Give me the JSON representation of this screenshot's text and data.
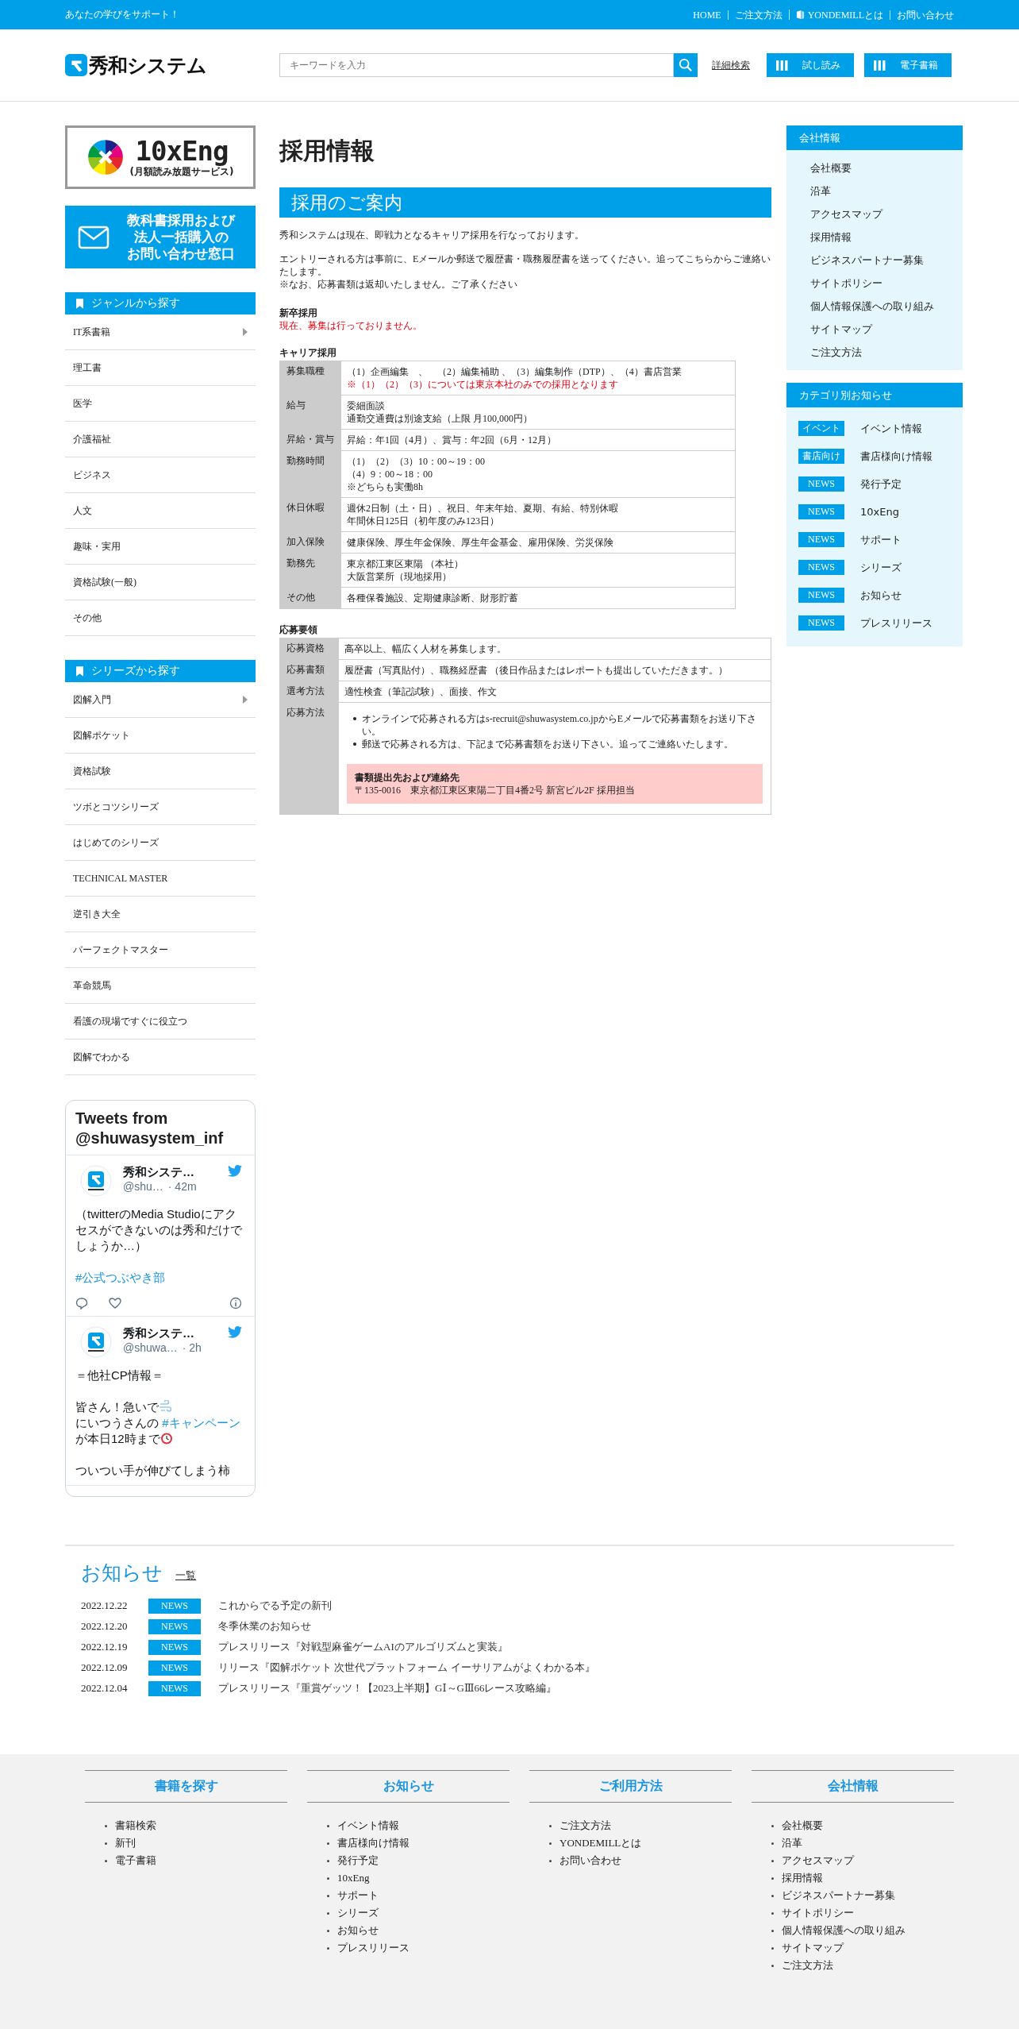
{
  "top_bar": {
    "tagline": "あなたの学びをサポート！",
    "links": [
      {
        "label": "HOME",
        "kind": "plain"
      },
      {
        "label": "ご注文方法",
        "kind": "plain"
      },
      {
        "label": "YONDEMILLとは",
        "kind": "app"
      },
      {
        "label": "お問い合わせ",
        "kind": "plain"
      }
    ]
  },
  "header": {
    "logo": "秀和システム",
    "search": {
      "placeholder": "キーワードを入力"
    },
    "advanced_search": "詳細検索",
    "buttons": [
      "試し読み",
      "電子書籍"
    ]
  },
  "left_sidebar": {
    "banner": {
      "title": "10xEng",
      "subtitle": "(月額読み放題サービス)"
    },
    "contact_banner": {
      "lines": [
        "教科書採用および",
        "法人一括購入の",
        "お問い合わせ窓口"
      ]
    },
    "genres": {
      "heading": "ジャンルから探す",
      "items": [
        {
          "label": "IT系書籍",
          "expandable": true
        },
        {
          "label": "理工書",
          "expandable": false
        },
        {
          "label": "医学",
          "expandable": false
        },
        {
          "label": "介護福祉",
          "expandable": false
        },
        {
          "label": "ビジネス",
          "expandable": false
        },
        {
          "label": "人文",
          "expandable": false
        },
        {
          "label": "趣味・実用",
          "expandable": false
        },
        {
          "label": "資格試験(一般)",
          "expandable": false
        },
        {
          "label": "その他",
          "expandable": false
        }
      ]
    },
    "series": {
      "heading": "シリーズから探す",
      "items": [
        {
          "label": "図解入門",
          "expandable": true
        },
        {
          "label": "図解ポケット",
          "expandable": false
        },
        {
          "label": "資格試験",
          "expandable": false
        },
        {
          "label": "ツボとコツシリーズ",
          "expandable": false
        },
        {
          "label": "はじめてのシリーズ",
          "expandable": false
        },
        {
          "label": "TECHNICAL MASTER",
          "expandable": false
        },
        {
          "label": "逆引き大全",
          "expandable": false
        },
        {
          "label": "パーフェクトマスター",
          "expandable": false
        },
        {
          "label": "革命競馬",
          "expandable": false
        },
        {
          "label": "看護の現場ですぐに役立つ",
          "expandable": false
        },
        {
          "label": "図解でわかる",
          "expandable": false
        }
      ]
    },
    "twitter": {
      "title": "Tweets from @shuwasystem_inf",
      "tweets": [
        {
          "name": "秀和システ…",
          "handle": "@shu…",
          "time": "· 42m",
          "body": [
            [
              [
                {
                  "kind": "text",
                  "text": "（twitterのMedia Studioにアクセスができないのは秀和だけでしょうか…）"
                }
              ]
            ],
            [
              [
                {
                  "kind": "tag",
                  "text": "#公式つぶやき部"
                }
              ]
            ]
          ],
          "actions": true
        },
        {
          "name": "秀和システ…",
          "handle": "@shuwa…",
          "time": "· 2h",
          "body": [
            [
              [
                {
                  "kind": "text",
                  "text": "＝他社CP情報＝"
                }
              ]
            ],
            [
              [
                {
                  "kind": "text",
                  "text": "皆さん！急いで"
                },
                {
                  "kind": "dash"
                }
              ],
              [
                {
                  "kind": "text",
                  "text": "にいつうさんの "
                },
                {
                  "kind": "tag",
                  "text": "#キャンペーン"
                },
                {
                  "kind": "text",
                  "text": " が本日12時まで"
                },
                {
                  "kind": "clock"
                }
              ]
            ],
            [
              [
                {
                  "kind": "text",
                  "text": "ついつい手が伸びてしまう柿"
                }
              ]
            ]
          ]
        }
      ]
    }
  },
  "main": {
    "title": "採用情報",
    "section_heading": "採用のご案内",
    "intro": [
      "秀和システムは現在、即戦力となるキャリア採用を行なっております。",
      "エントリーされる方は事前に、Eメールか郵送で履歴書・職務履歴書を送ってください。追ってこちらからご連絡いたします。\n※なお、応募書類は返却いたしません。ご了承ください"
    ],
    "new_grad": {
      "heading": "新卒採用",
      "notice": "現在、募集は行っておりません。"
    },
    "career": {
      "heading": "キャリア採用",
      "rows": [
        {
          "label": "募集職種",
          "lines": [
            "（1）企画編集　、　（2）編集補助 、（3）編集制作（DTP）、（4）書店営業"
          ],
          "note": "※（1）（2）（3）については東京本社のみでの採用となります"
        },
        {
          "label": "給与",
          "lines": [
            "委細面談",
            "通勤交通費は別途支給（上限 月100,000円）"
          ]
        },
        {
          "label": "昇給・賞与",
          "lines": [
            "昇給：年1回（4月）、賞与：年2回（6月・12月）"
          ]
        },
        {
          "label": "勤務時間",
          "lines": [
            "（1）（2）（3）10：00～19：00",
            "（4）9：00～18：00",
            "※どちらも実働8h"
          ]
        },
        {
          "label": "休日休暇",
          "lines": [
            "週休2日制（土・日）、祝日、年末年始、夏期、有給、特別休暇",
            "年間休日125日（初年度のみ123日）"
          ]
        },
        {
          "label": "加入保険",
          "lines": [
            "健康保険、厚生年金保険、厚生年金基金、雇用保険、労災保険"
          ]
        },
        {
          "label": "勤務先",
          "lines": [
            "東京都江東区東陽 （本社）",
            "大阪営業所（現地採用）"
          ]
        },
        {
          "label": "その他",
          "lines": [
            "各種保養施設、定期健康診断、財形貯蓄"
          ]
        }
      ]
    },
    "application": {
      "heading": "応募要領",
      "rows": [
        {
          "label": "応募資格",
          "text": "高卒以上、幅広く人材を募集します。"
        },
        {
          "label": "応募書類",
          "text": "履歴書（写真貼付）、職務経歴書 （後日作品またはレポートも提出していただきます。）"
        },
        {
          "label": "選考方法",
          "text": "適性検査（筆記試験）、面接、作文"
        }
      ],
      "method": {
        "label": "応募方法",
        "bullets": [
          "オンラインで応募される方はs-recruit@shuwasystem.co.jpからEメールで応募書類をお送り下さい。",
          "郵送で応募される方は、下記まで応募書類をお送り下さい。追ってご連絡いたします。"
        ],
        "contact": {
          "heading": "書類提出先および連絡先",
          "address": "〒135-0016　東京都江東区東陽二丁目4番2号 新宮ビル2F 採用担当"
        }
      }
    }
  },
  "right_sidebar": {
    "company": {
      "heading": "会社情報",
      "items": [
        "会社概要",
        "沿革",
        "アクセスマップ",
        "採用情報",
        "ビジネスパートナー募集",
        "サイトポリシー",
        "個人情報保護への取り組み",
        "サイトマップ",
        "ご注文方法"
      ]
    },
    "categories": {
      "heading": "カテゴリ別お知らせ",
      "items": [
        {
          "tag": "イベント",
          "label": "イベント情報"
        },
        {
          "tag": "書店向け",
          "label": "書店様向け情報"
        },
        {
          "tag": "NEWS",
          "label": "発行予定"
        },
        {
          "tag": "NEWS",
          "label": "10xEng"
        },
        {
          "tag": "NEWS",
          "label": "サポート"
        },
        {
          "tag": "NEWS",
          "label": "シリーズ"
        },
        {
          "tag": "NEWS",
          "label": "お知らせ"
        },
        {
          "tag": "NEWS",
          "label": "プレスリリース"
        }
      ]
    }
  },
  "news": {
    "heading": "お知らせ",
    "more_link": "一覧",
    "items": [
      {
        "date": "2022.12.22",
        "tag": "NEWS",
        "title": "これからでる予定の新刊"
      },
      {
        "date": "2022.12.20",
        "tag": "NEWS",
        "title": "冬季休業のお知らせ"
      },
      {
        "date": "2022.12.19",
        "tag": "NEWS",
        "title": "プレスリリース『対戦型麻雀ゲームAIのアルゴリズムと実装』"
      },
      {
        "date": "2022.12.09",
        "tag": "NEWS",
        "title": "リリース『図解ポケット 次世代プラットフォーム イーサリアムがよくわかる本』"
      },
      {
        "date": "2022.12.04",
        "tag": "NEWS",
        "title": "プレスリリース『重賞ゲッツ！【2023上半期】GⅠ～GⅢ66レース攻略編』"
      }
    ]
  },
  "footer": {
    "columns": [
      {
        "heading": "書籍を探す",
        "links": [
          "書籍検索",
          "新刊",
          "電子書籍"
        ]
      },
      {
        "heading": "お知らせ",
        "links": [
          "イベント情報",
          "書店様向け情報",
          "発行予定",
          "10xEng",
          "サポート",
          "シリーズ",
          "お知らせ",
          "プレスリリース"
        ]
      },
      {
        "heading": "ご利用方法",
        "links": [
          "ご注文方法",
          "YONDEMILLとは",
          "お問い合わせ"
        ]
      },
      {
        "heading": "会社情報",
        "links": [
          "会社概要",
          "沿革",
          "アクセスマップ",
          "採用情報",
          "ビジネスパートナー募集",
          "サイトポリシー",
          "個人情報保護への取り組み",
          "サイトマップ",
          "ご注文方法"
        ]
      }
    ]
  }
}
